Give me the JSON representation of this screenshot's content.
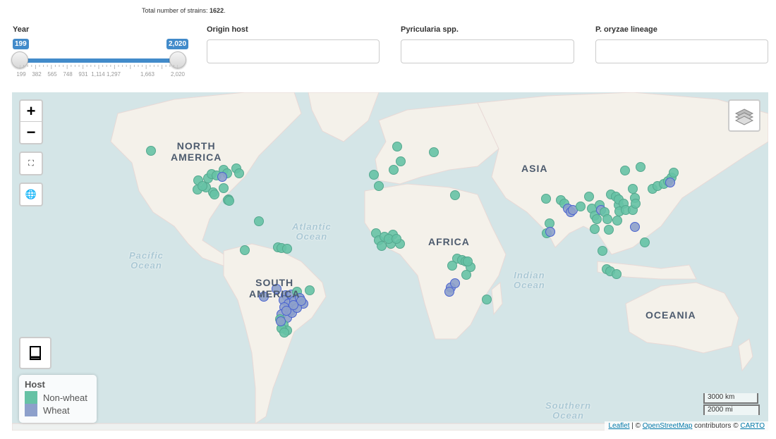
{
  "header": {
    "total_prefix": "Total number of strains: ",
    "total_value": "1622",
    "total_suffix": "."
  },
  "filters": {
    "year": {
      "label": "Year",
      "min_value": "199",
      "max_value": "2,020",
      "ticks": [
        "199",
        "382",
        "565",
        "748",
        "931",
        "1,114",
        "1,297",
        "1,663",
        "2,020"
      ]
    },
    "origin_host": {
      "label": "Origin host",
      "value": ""
    },
    "pyricularia": {
      "label": "Pyricularia spp.",
      "value": ""
    },
    "lineage": {
      "label": "P. oryzae lineage",
      "value": ""
    }
  },
  "map": {
    "continent_labels": {
      "north_america": [
        "NORTH",
        "AMERICA"
      ],
      "south_america": [
        "SOUTH",
        "AMERICA"
      ],
      "africa": "AFRICA",
      "asia": "ASIA",
      "oceania": "OCEANIA"
    },
    "ocean_labels": {
      "atlantic": [
        "Atlantic",
        "Ocean"
      ],
      "pacific": [
        "Pacific",
        "Ocean"
      ],
      "indian": [
        "Indian",
        "Ocean"
      ],
      "southern": [
        "Southern",
        "Ocean"
      ]
    },
    "controls": {
      "zoom_in": "+",
      "zoom_out": "−",
      "fullscreen": "⛶",
      "globe": "🌐"
    },
    "legend": {
      "title": "Host",
      "items": [
        {
          "label": "Non-wheat",
          "color": "#66c2a5"
        },
        {
          "label": "Wheat",
          "color": "#8da0cb"
        }
      ]
    },
    "scale": {
      "km": "3000 km",
      "mi": "2000 mi"
    },
    "attribution": {
      "leaflet": "Leaflet",
      "sep": " | © ",
      "osm": "OpenStreetMap",
      "contrib": " contributors © ",
      "carto": "CARTO"
    },
    "marker_colors": {
      "non_wheat": "#66c2a5",
      "wheat": "#8da0cb"
    }
  }
}
